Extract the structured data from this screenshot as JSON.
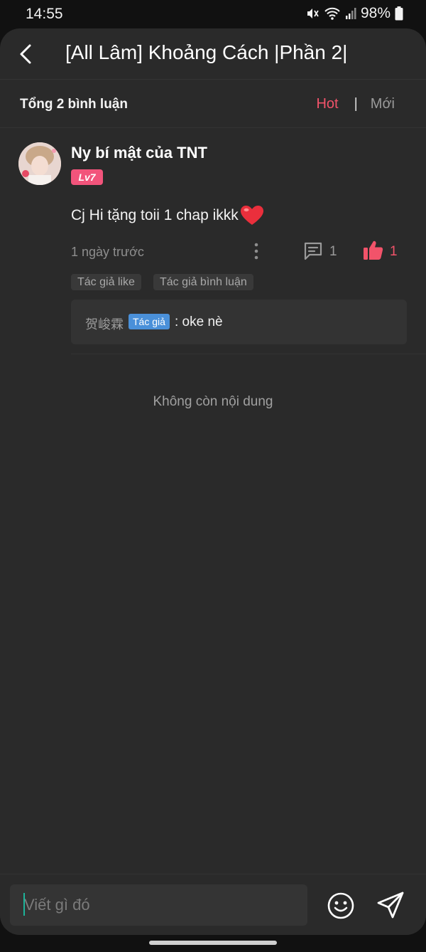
{
  "status_bar": {
    "time": "14:55",
    "battery": "98%"
  },
  "header": {
    "title": "[All Lâm] Khoảng Cách |Phần 2|"
  },
  "comment_bar": {
    "count": "Tổng 2 bình luận",
    "sort_hot": "Hot",
    "separator": "|",
    "sort_new": "Mới"
  },
  "comment": {
    "username": "Ny bí mật của TNT",
    "level": "Lv7",
    "text": "Cj Hi tặng toii 1 chap ikkk",
    "timestamp": "1 ngày trước",
    "reply_count": "1",
    "like_count": "1",
    "tags": [
      "Tác giả like",
      "Tác giả bình luận"
    ],
    "reply": {
      "author": "贺峻霖",
      "badge": "Tác giả",
      "text": ": oke nè"
    }
  },
  "no_more": "Không còn nội dung",
  "footer": {
    "placeholder": "Viết gì đó"
  },
  "colors": {
    "accent": "#f2536a",
    "badge_pink": "#f2547b",
    "author_blue": "#4a90d9",
    "background": "#2a2a2a"
  },
  "icons": [
    "back-icon",
    "mute-icon",
    "wifi-icon",
    "signal-icon",
    "battery-icon",
    "more-icon",
    "reply-icon",
    "like-icon",
    "heart-icon",
    "emoji-icon",
    "send-icon"
  ]
}
